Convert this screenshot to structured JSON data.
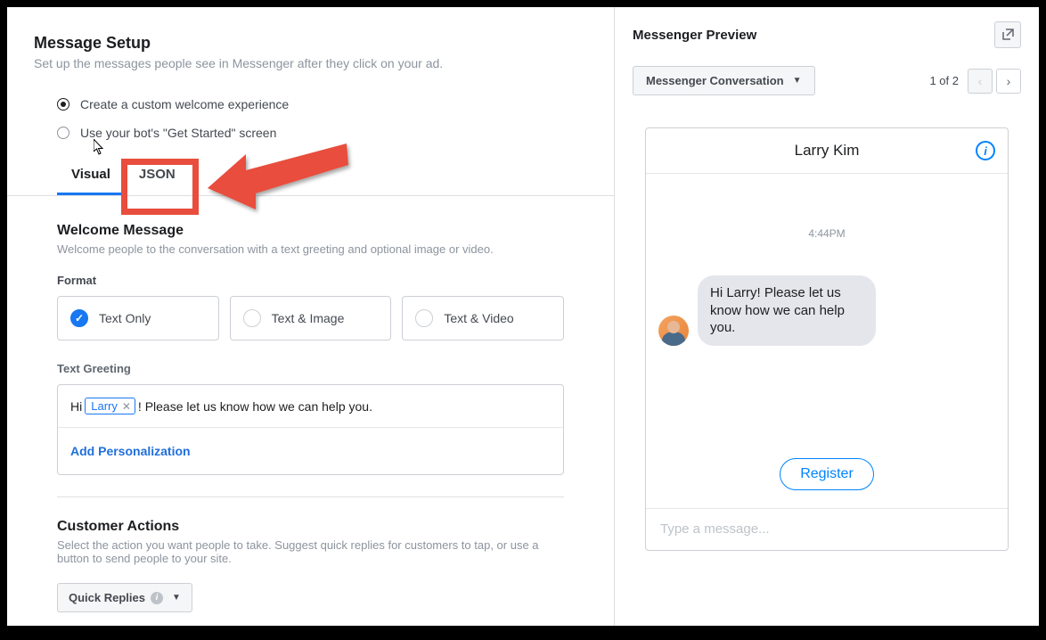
{
  "setup": {
    "title": "Message Setup",
    "subtitle": "Set up the messages people see in Messenger after they click on your ad.",
    "options": {
      "custom": "Create a custom welcome experience",
      "bot": "Use your bot's \"Get Started\" screen"
    },
    "tabs": {
      "visual": "Visual",
      "json": "JSON"
    }
  },
  "welcome": {
    "title": "Welcome Message",
    "subtitle": "Welcome people to the conversation with a text greeting and optional image or video.",
    "format_label": "Format",
    "formats": {
      "text_only": "Text Only",
      "text_image": "Text & Image",
      "text_video": "Text & Video"
    },
    "greeting_label": "Text Greeting",
    "greeting_pre": "Hi ",
    "greeting_token": "Larry",
    "greeting_post": "! Please let us know how we can help you.",
    "personalization": "Add Personalization"
  },
  "actions": {
    "title": "Customer Actions",
    "subtitle": "Select the action you want people to take. Suggest quick replies for customers to tap, or use a button to send people to your site.",
    "dropdown": "Quick Replies"
  },
  "preview": {
    "title": "Messenger Preview",
    "dropdown": "Messenger Conversation",
    "page_indicator": "1 of 2",
    "contact": "Larry Kim",
    "timestamp": "4:44PM",
    "bubble_text": "Hi Larry! Please let us know how we can help you.",
    "register": "Register",
    "input_placeholder": "Type a message..."
  }
}
